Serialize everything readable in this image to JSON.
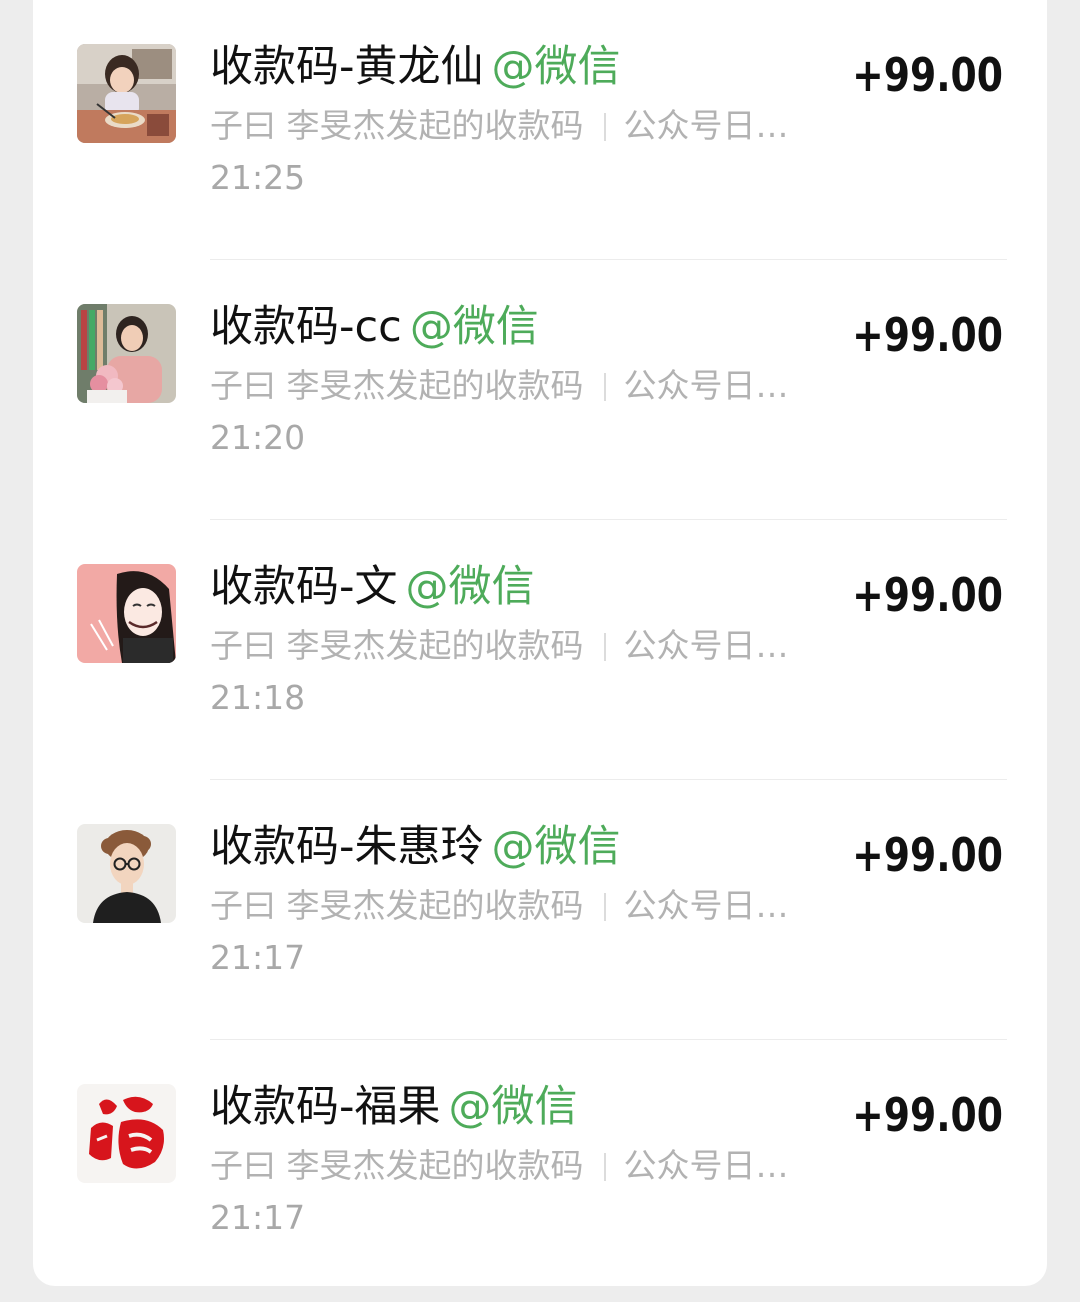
{
  "colors": {
    "tag": "#4eab5a",
    "amount": "#111111",
    "secondary": "#b2b2b2"
  },
  "records": [
    {
      "title": "收款码-黄龙仙",
      "tag": "@微信",
      "subtitle_left": "子曰 李旻杰发起的收款码",
      "subtitle_right": "公众号日…",
      "time": "21:25",
      "amount": "+99.00",
      "avatar": "child-eating-photo"
    },
    {
      "title": "收款码-cc",
      "tag": "@微信",
      "subtitle_left": "子曰 李旻杰发起的收款码",
      "subtitle_right": "公众号日…",
      "time": "21:20",
      "amount": "+99.00",
      "avatar": "woman-with-flowers-photo"
    },
    {
      "title": "收款码-文",
      "tag": "@微信",
      "subtitle_left": "子曰 李旻杰发起的收款码",
      "subtitle_right": "公众号日…",
      "time": "21:18",
      "amount": "+99.00",
      "avatar": "cartoon-girl-pink"
    },
    {
      "title": "收款码-朱惠玲",
      "tag": "@微信",
      "subtitle_left": "子曰 李旻杰发起的收款码",
      "subtitle_right": "公众号日…",
      "time": "21:17",
      "amount": "+99.00",
      "avatar": "cartoon-person-glasses"
    },
    {
      "title": "收款码-福果",
      "tag": "@微信",
      "subtitle_left": "子曰 李旻杰发起的收款码",
      "subtitle_right": "公众号日…",
      "time": "21:17",
      "amount": "+99.00",
      "avatar": "fu-character-logo"
    }
  ]
}
